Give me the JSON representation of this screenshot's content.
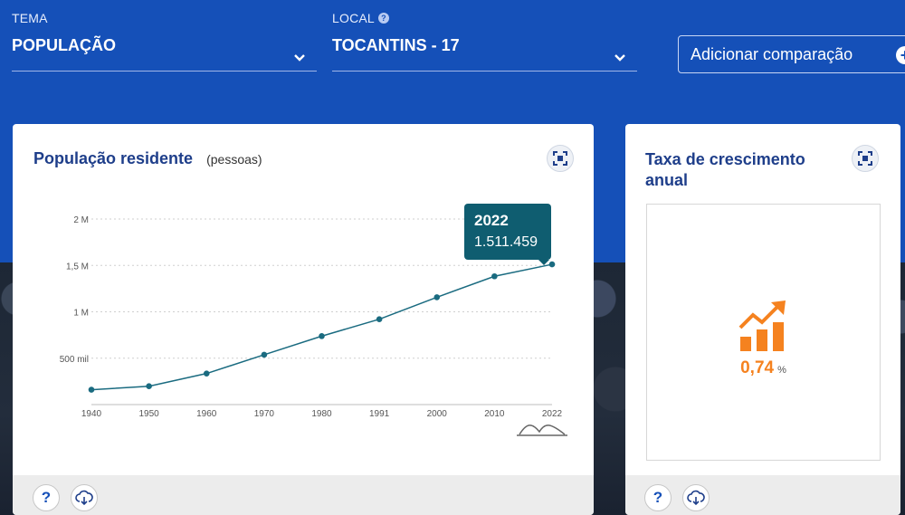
{
  "filters": {
    "tema": {
      "label": "TEMA",
      "value": "POPULAÇÃO"
    },
    "local": {
      "label": "LOCAL",
      "value": "TOCANTINS - 17"
    },
    "compare_label": "Adicionar comparação"
  },
  "population_card": {
    "title": "População residente",
    "unit": "(pessoas)",
    "tooltip": {
      "year": "2022",
      "value": "1.511.459"
    }
  },
  "growth_card": {
    "title_line1": "Taxa de crescimento",
    "title_line2": "anual",
    "value": "0,74",
    "unit": "%"
  },
  "colors": {
    "header": "#1550b8",
    "title": "#1e3e8a",
    "line": "#1a6b80",
    "accent": "#f5821f"
  },
  "chart_data": {
    "type": "line",
    "x": [
      "1940",
      "1950",
      "1960",
      "1970",
      "1980",
      "1991",
      "2000",
      "2010",
      "2022"
    ],
    "values": [
      160000,
      198000,
      335000,
      537000,
      738000,
      920000,
      1157000,
      1383000,
      1511459
    ],
    "ytick_labels": [
      "500 mil",
      "1 M",
      "1,5 M",
      "2 M"
    ],
    "ytick_values": [
      500000,
      1000000,
      1500000,
      2000000
    ],
    "ylim": [
      0,
      2000000
    ],
    "grid": true
  }
}
